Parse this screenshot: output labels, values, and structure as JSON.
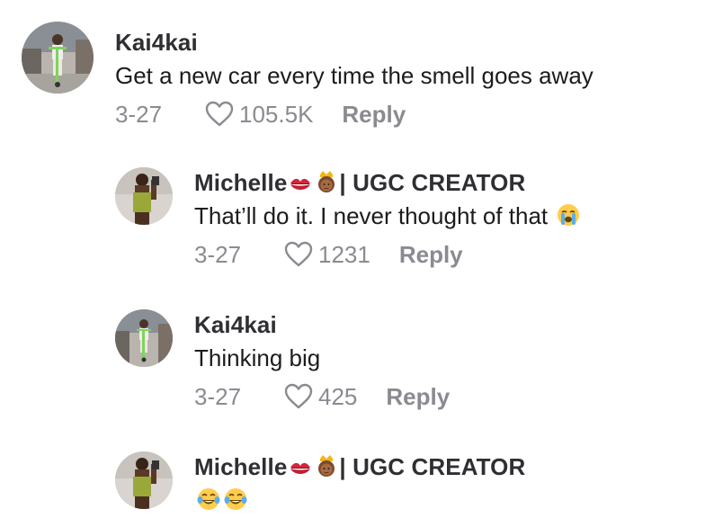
{
  "comments": [
    {
      "username": "Kai4kai",
      "text": "Get a new car every time the smell goes away",
      "date": "3-27",
      "likes": "105.5K",
      "reply_label": "Reply",
      "avatar_icon": "avatar-person-scooter"
    },
    {
      "username_prefix": "Michelle",
      "username_emojis": [
        "kiss-mark-icon",
        "princess-icon"
      ],
      "username_suffix": "| UGC CREATOR",
      "text": "That’ll do it. I never thought of that",
      "text_emoji": "loudly-crying-face-icon",
      "date": "3-27",
      "likes": "1231",
      "reply_label": "Reply",
      "avatar_icon": "avatar-person-green-top"
    },
    {
      "username": "Kai4kai",
      "text": "Thinking big",
      "date": "3-27",
      "likes": "425",
      "reply_label": "Reply",
      "avatar_icon": "avatar-person-scooter"
    },
    {
      "username_prefix": "Michelle",
      "username_emojis": [
        "kiss-mark-icon",
        "princess-icon"
      ],
      "username_suffix": "| UGC CREATOR",
      "text_emojis": [
        "tears-of-joy-icon",
        "tears-of-joy-icon"
      ],
      "avatar_icon": "avatar-person-green-top"
    }
  ],
  "colors": {
    "text": "#1c1c1f",
    "username": "#2f2f33",
    "meta": "#8a8b91",
    "background": "#ffffff"
  }
}
